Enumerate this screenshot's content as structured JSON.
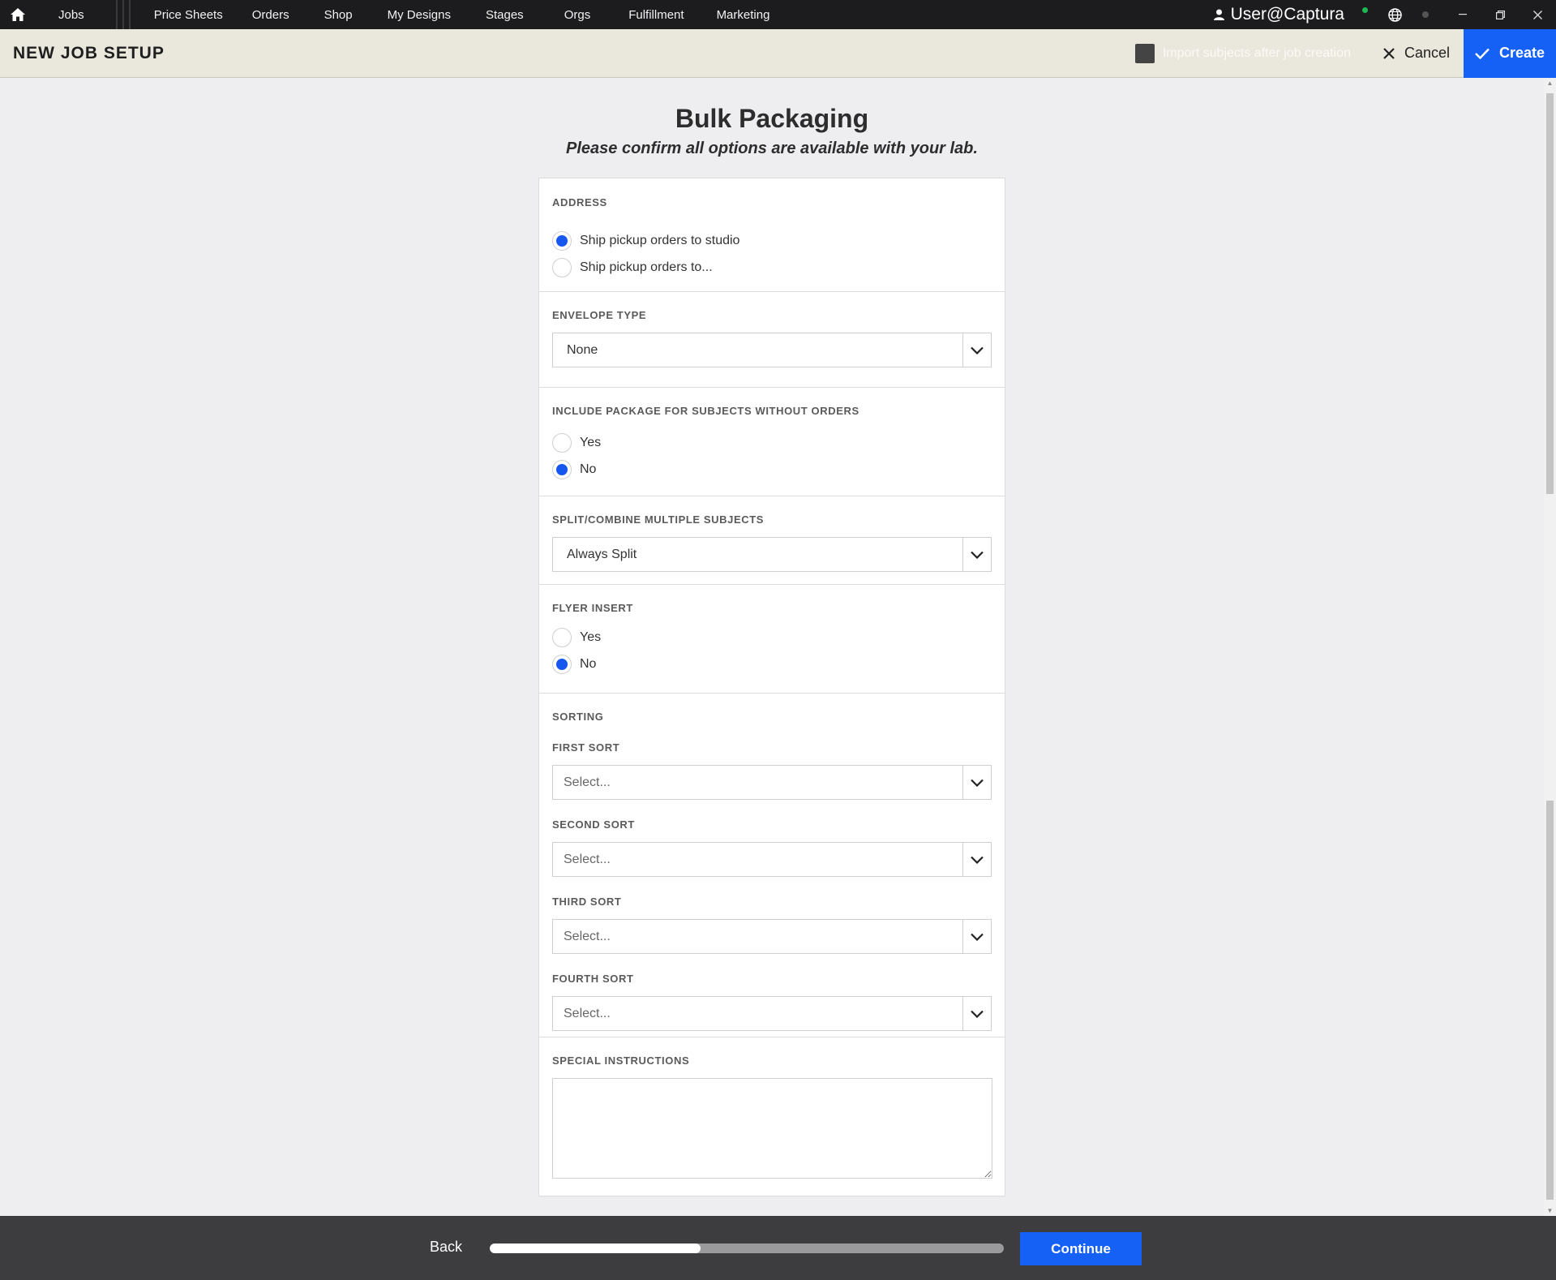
{
  "nav": {
    "items": [
      "Jobs",
      "Price Sheets",
      "Orders",
      "Shop",
      "My Designs",
      "Stages",
      "Orgs",
      "Fulfillment",
      "Marketing"
    ],
    "user": "User@Captura"
  },
  "header": {
    "title": "NEW JOB SETUP",
    "import_label": "Import subjects after job creation",
    "import_checked": false,
    "cancel_label": "Cancel",
    "create_label": "Create"
  },
  "page": {
    "title": "Bulk Packaging",
    "subtitle": "Please confirm all options are available with your lab."
  },
  "form": {
    "address": {
      "label": "ADDRESS",
      "options": [
        {
          "label": "Ship pickup orders to studio",
          "checked": true
        },
        {
          "label": "Ship pickup orders to...",
          "checked": false
        }
      ]
    },
    "envelope": {
      "label": "ENVELOPE TYPE",
      "value": "None"
    },
    "include_package": {
      "label": "INCLUDE PACKAGE FOR SUBJECTS WITHOUT ORDERS",
      "options": [
        {
          "label": "Yes",
          "checked": false
        },
        {
          "label": "No",
          "checked": true
        }
      ]
    },
    "split_combine": {
      "label": "SPLIT/COMBINE MULTIPLE SUBJECTS",
      "value": "Always Split"
    },
    "flyer": {
      "label": "FLYER INSERT",
      "options": [
        {
          "label": "Yes",
          "checked": false
        },
        {
          "label": "No",
          "checked": true
        }
      ]
    },
    "sorting": {
      "label": "SORTING",
      "first": {
        "label": "FIRST SORT",
        "placeholder": "Select..."
      },
      "second": {
        "label": "SECOND SORT",
        "placeholder": "Select..."
      },
      "third": {
        "label": "THIRD SORT",
        "placeholder": "Select..."
      },
      "fourth": {
        "label": "FOURTH SORT",
        "placeholder": "Select..."
      }
    },
    "special_instructions": {
      "label": "SPECIAL INSTRUCTIONS",
      "value": ""
    }
  },
  "footer": {
    "back_label": "Back",
    "continue_label": "Continue",
    "progress_fraction": 0.41
  },
  "colors": {
    "accent": "#1560f5",
    "topbar": "#1c1c1e",
    "header_bg": "#eae7dc",
    "footer_bg": "#3d3d40",
    "radio_checked": "#1657f0"
  }
}
